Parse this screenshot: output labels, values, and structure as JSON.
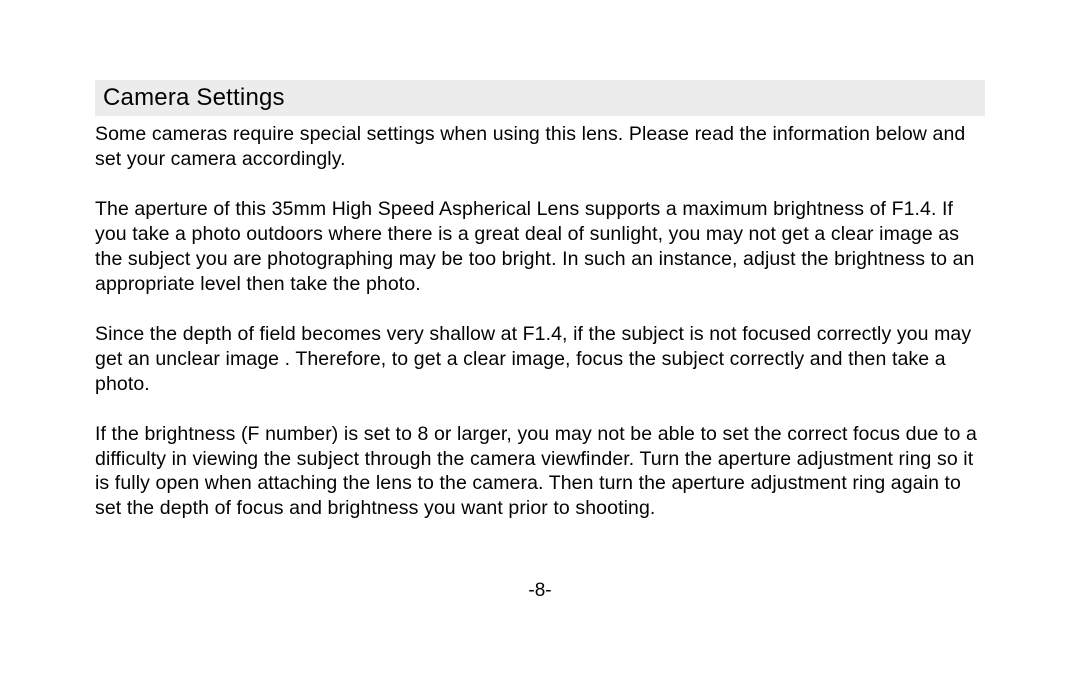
{
  "heading": "Camera Settings",
  "paragraphs": {
    "p1": "Some cameras require special settings when using this lens. Please read the information below and set your camera accordingly.",
    "p2": "The aperture of this 35mm High Speed Aspherical Lens supports a maximum brightness of F1.4. If you take a photo outdoors where there is a great deal of sunlight, you may not get a clear image as the subject you are photographing  may be too bright.  In such an instance, adjust the brightness to an appropriate level then take the photo.",
    "p3": "Since the depth of field becomes very shallow at F1.4, if the subject is not focused correctly you may get an unclear image .  Therefore, to get a clear image, focus the subject correctly and then take a photo.",
    "p4": "If the brightness (F number) is set to 8 or larger, you may not be able to set the correct focus due to a difficulty in viewing the subject through the camera viewfinder. Turn the aperture adjustment ring so it is fully open when attaching the lens to the camera. Then turn the aperture adjustment ring again to set the depth of focus and brightness you want prior to shooting."
  },
  "page_number": "-8-"
}
